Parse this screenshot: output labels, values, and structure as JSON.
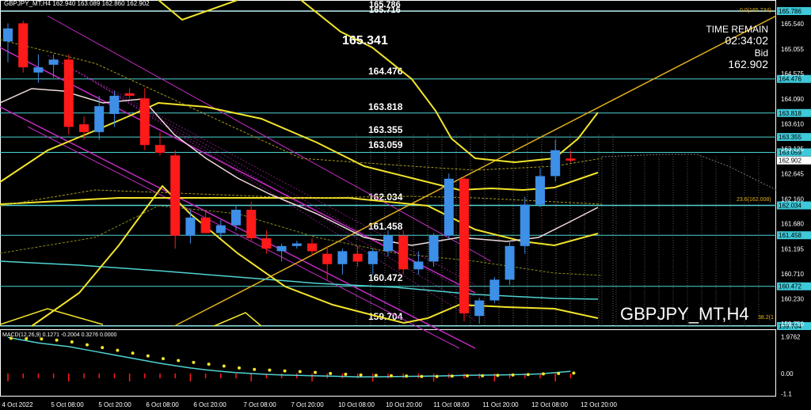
{
  "header": {
    "symbol_tf": "GBPJPY_MT,H4",
    "ohlc": "162.940 163.089 162.860 162.902"
  },
  "top_price": "165.786",
  "top_price_overlap": "165.716",
  "big_level": "165.341",
  "time_remain_label": "TIME REMAIN",
  "time_remain_value": "02:34:02",
  "bid_label": "Bid",
  "bid_value": "162.902",
  "watermark": "GBPJPY_MT,H4",
  "fib_top": "0.0(165.734)",
  "fib_mid": "23.6(162.008)",
  "fib_bot": "38.2(1",
  "macd_label": "MACD(12,26,9) 0.1271 -0.2004 0.3276 0.0000",
  "colors": {
    "bull": "#3d8fe8",
    "bear": "#ff1a1a",
    "level_line": "#4fd3d3",
    "yellow": "#f2e42a",
    "magenta": "#c42bc4",
    "cyan": "#4fd3d3",
    "gold": "#e6b21c",
    "pink": "#f0dcdc",
    "badge_bg": "#3ec8d8"
  },
  "chart_data": {
    "type": "candlestick",
    "ylim": [
      159.704,
      166.0
    ],
    "y_ticks": [
      "165.786",
      "165.716",
      "165.540",
      "165.055",
      "164.575",
      "164.476",
      "164.090",
      "163.818",
      "163.610",
      "163.355",
      "163.125",
      "163.059",
      "162.902",
      "162.645",
      "162.160",
      "162.034",
      "161.680",
      "161.458",
      "161.195",
      "160.710",
      "160.472",
      "160.230",
      "159.750",
      "159.704"
    ],
    "levels": [
      {
        "value": 165.786,
        "label": "165.786"
      },
      {
        "value": 164.476,
        "label": "164.476"
      },
      {
        "value": 163.818,
        "label": "163.818"
      },
      {
        "value": 163.355,
        "label": "163.355"
      },
      {
        "value": 163.059,
        "label": "163.059"
      },
      {
        "value": 162.034,
        "label": "162.034"
      },
      {
        "value": 161.458,
        "label": "161.458"
      },
      {
        "value": 160.472,
        "label": "160.472"
      },
      {
        "value": 159.704,
        "label": "159.704"
      }
    ],
    "level_labels_shown": [
      "164.476",
      "163.818",
      "163.355",
      "163.059",
      "162.034",
      "161.458",
      "160.472",
      "159.704"
    ],
    "x_labels": [
      "4 Oct 2022",
      "5 Oct 08:00",
      "5 Oct 20:00",
      "6 Oct 08:00",
      "6 Oct 20:00",
      "7 Oct 08:00",
      "7 Oct 20:00",
      "10 Oct 08:00",
      "10 Oct 20:00",
      "11 Oct 08:00",
      "11 Oct 20:00",
      "12 Oct 08:00",
      "12 Oct 20:00"
    ],
    "candles": [
      {
        "o": 165.2,
        "h": 165.55,
        "l": 164.8,
        "c": 165.45
      },
      {
        "o": 165.55,
        "h": 165.6,
        "l": 164.6,
        "c": 164.7
      },
      {
        "o": 164.6,
        "h": 164.95,
        "l": 164.4,
        "c": 164.7
      },
      {
        "o": 164.75,
        "h": 164.95,
        "l": 164.5,
        "c": 164.85
      },
      {
        "o": 164.85,
        "h": 164.95,
        "l": 163.4,
        "c": 163.55
      },
      {
        "o": 163.6,
        "h": 163.75,
        "l": 163.3,
        "c": 163.45
      },
      {
        "o": 163.45,
        "h": 164.15,
        "l": 163.3,
        "c": 163.95
      },
      {
        "o": 163.8,
        "h": 164.25,
        "l": 163.55,
        "c": 164.15
      },
      {
        "o": 164.2,
        "h": 164.3,
        "l": 164.1,
        "c": 164.15
      },
      {
        "o": 164.1,
        "h": 164.3,
        "l": 163.1,
        "c": 163.2
      },
      {
        "o": 163.2,
        "h": 163.45,
        "l": 163.0,
        "c": 163.05
      },
      {
        "o": 163.0,
        "h": 163.1,
        "l": 161.2,
        "c": 161.45
      },
      {
        "o": 161.45,
        "h": 161.95,
        "l": 161.3,
        "c": 161.8
      },
      {
        "o": 161.8,
        "h": 161.95,
        "l": 161.55,
        "c": 161.5
      },
      {
        "o": 161.5,
        "h": 161.75,
        "l": 161.4,
        "c": 161.65
      },
      {
        "o": 161.65,
        "h": 162.05,
        "l": 161.55,
        "c": 161.95
      },
      {
        "o": 161.95,
        "h": 162.1,
        "l": 161.35,
        "c": 161.4
      },
      {
        "o": 161.4,
        "h": 161.55,
        "l": 161.1,
        "c": 161.2
      },
      {
        "o": 161.15,
        "h": 161.3,
        "l": 160.95,
        "c": 161.25
      },
      {
        "o": 161.25,
        "h": 161.35,
        "l": 161.2,
        "c": 161.3
      },
      {
        "o": 161.3,
        "h": 161.4,
        "l": 161.05,
        "c": 161.15
      },
      {
        "o": 161.1,
        "h": 161.25,
        "l": 160.6,
        "c": 160.9
      },
      {
        "o": 160.9,
        "h": 161.2,
        "l": 160.7,
        "c": 161.15
      },
      {
        "o": 161.1,
        "h": 161.25,
        "l": 160.85,
        "c": 160.95
      },
      {
        "o": 160.9,
        "h": 161.2,
        "l": 160.7,
        "c": 161.15
      },
      {
        "o": 161.15,
        "h": 161.55,
        "l": 161.05,
        "c": 161.45
      },
      {
        "o": 161.45,
        "h": 161.55,
        "l": 160.7,
        "c": 160.8
      },
      {
        "o": 160.8,
        "h": 161.15,
        "l": 160.7,
        "c": 160.95
      },
      {
        "o": 160.95,
        "h": 161.5,
        "l": 160.85,
        "c": 161.45
      },
      {
        "o": 161.45,
        "h": 162.65,
        "l": 161.4,
        "c": 162.55
      },
      {
        "o": 162.55,
        "h": 162.6,
        "l": 159.8,
        "c": 159.95
      },
      {
        "o": 159.9,
        "h": 160.25,
        "l": 159.75,
        "c": 160.2
      },
      {
        "o": 160.2,
        "h": 160.65,
        "l": 160.15,
        "c": 160.6
      },
      {
        "o": 160.6,
        "h": 161.35,
        "l": 160.5,
        "c": 161.25
      },
      {
        "o": 161.25,
        "h": 162.2,
        "l": 161.1,
        "c": 162.05
      },
      {
        "o": 162.05,
        "h": 162.75,
        "l": 162.0,
        "c": 162.6
      },
      {
        "o": 162.6,
        "h": 163.3,
        "l": 162.5,
        "c": 163.1
      },
      {
        "o": 162.94,
        "h": 163.09,
        "l": 162.86,
        "c": 162.9
      }
    ],
    "macd_ticks": [
      "1.9762",
      "0.00",
      "-1.1"
    ],
    "macd_signal_dots": [
      1.9,
      1.88,
      1.86,
      1.8,
      1.7,
      1.55,
      1.4,
      1.25,
      1.1,
      0.95,
      0.8,
      0.7,
      0.6,
      0.5,
      0.4,
      0.3,
      0.22,
      0.18,
      0.14,
      0.1,
      0.06,
      0.0,
      -0.04,
      -0.08,
      -0.1,
      -0.12,
      -0.14,
      -0.16,
      -0.16,
      -0.14,
      -0.12,
      -0.12,
      -0.1,
      -0.08,
      -0.06,
      -0.02,
      0.0,
      0.02
    ],
    "macd_main": [
      1.95,
      1.8,
      1.65,
      1.55,
      1.45,
      1.3,
      1.15,
      1.0,
      0.85,
      0.7,
      0.55,
      0.42,
      0.3,
      0.2,
      0.12,
      0.05,
      0.0,
      -0.05,
      -0.08,
      -0.1,
      -0.12,
      -0.14,
      -0.16,
      -0.18,
      -0.18,
      -0.17,
      -0.16,
      -0.15,
      -0.14,
      -0.12,
      -0.1,
      -0.09,
      -0.08,
      -0.07,
      -0.05,
      -0.02,
      0.05,
      0.12
    ]
  }
}
